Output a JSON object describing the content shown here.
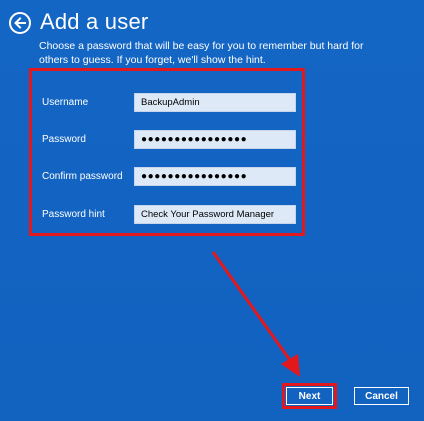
{
  "header": {
    "back_icon": "back-arrow-icon",
    "title": "Add a user",
    "description": "Choose a password that will be easy for you to remember but hard for others to guess. If you forget, we'll show the hint."
  },
  "form": {
    "username_label": "Username",
    "username_value": "BackupAdmin",
    "password_label": "Password",
    "password_value": "●●●●●●●●●●●●●●●●",
    "confirm_label": "Confirm password",
    "confirm_value": "●●●●●●●●●●●●●●●●",
    "hint_label": "Password hint",
    "hint_value": "Check Your Password Manager"
  },
  "buttons": {
    "next_label": "Next",
    "cancel_label": "Cancel"
  },
  "colors": {
    "background": "#1466c4",
    "highlight": "#e3181d",
    "field": "#dde9f7"
  }
}
